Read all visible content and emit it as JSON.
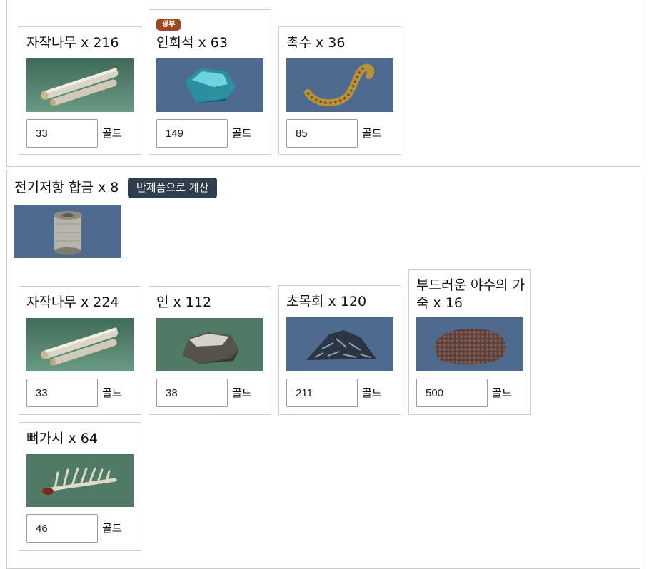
{
  "top_group": {
    "materials": [
      {
        "name": "자작나무 x 216",
        "value": "33",
        "unit": "골드",
        "icon": "birch-wood-icon",
        "bg": "green"
      },
      {
        "name": "인회석 x 63",
        "badge": "광부",
        "value": "149",
        "unit": "골드",
        "icon": "apatite-stone-icon",
        "bg": "blue"
      },
      {
        "name": "촉수 x 36",
        "value": "85",
        "unit": "골드",
        "icon": "tentacle-icon",
        "bg": "blue"
      }
    ]
  },
  "alloy": {
    "title": "전기저항 합금 x 8",
    "button_label": "반제품으로 계산",
    "icon": "wire-spool-icon",
    "materials": [
      {
        "name": "자작나무 x 224",
        "value": "33",
        "unit": "골드",
        "icon": "birch-wood-icon",
        "bg": "green"
      },
      {
        "name": "인 x 112",
        "value": "38",
        "unit": "골드",
        "icon": "phosphorus-rock-icon",
        "bg": "green"
      },
      {
        "name": "초목회 x 120",
        "value": "211",
        "unit": "골드",
        "icon": "plant-ash-icon",
        "bg": "blue"
      },
      {
        "name": "부드러운 야수의 가죽 x 16",
        "value": "500",
        "unit": "골드",
        "icon": "beast-leather-icon",
        "bg": "blue"
      },
      {
        "name": "뼈가시 x 64",
        "value": "46",
        "unit": "골드",
        "icon": "bone-spike-icon",
        "bg": "green"
      }
    ]
  },
  "colors": {
    "green_bg": "#4f7a66",
    "blue_bg": "#4e6a8e",
    "badge": "#9a4a1e",
    "button": "#2e3e4f"
  }
}
